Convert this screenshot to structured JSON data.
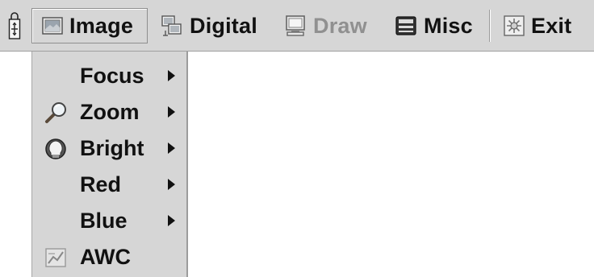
{
  "menubar": {
    "items": [
      {
        "label": "Image",
        "icon": "image-icon",
        "active": true
      },
      {
        "label": "Digital",
        "icon": "digital-icon"
      },
      {
        "label": "Draw",
        "icon": "draw-icon",
        "disabled": true
      },
      {
        "label": "Misc",
        "icon": "misc-icon"
      },
      {
        "label": "Exit",
        "icon": "exit-icon"
      }
    ]
  },
  "dropdown": {
    "items": [
      {
        "label": "Focus",
        "submenu": true
      },
      {
        "label": "Zoom",
        "icon": "magnifier-icon",
        "submenu": true
      },
      {
        "label": "Bright",
        "icon": "bulb-icon",
        "submenu": true
      },
      {
        "label": "Red",
        "submenu": true
      },
      {
        "label": "Blue",
        "submenu": true
      },
      {
        "label": "AWC",
        "icon": "awc-icon"
      }
    ]
  },
  "colors": {
    "menubar_bg": "#d6d6d6",
    "text": "#111111",
    "disabled_text": "#909090"
  }
}
